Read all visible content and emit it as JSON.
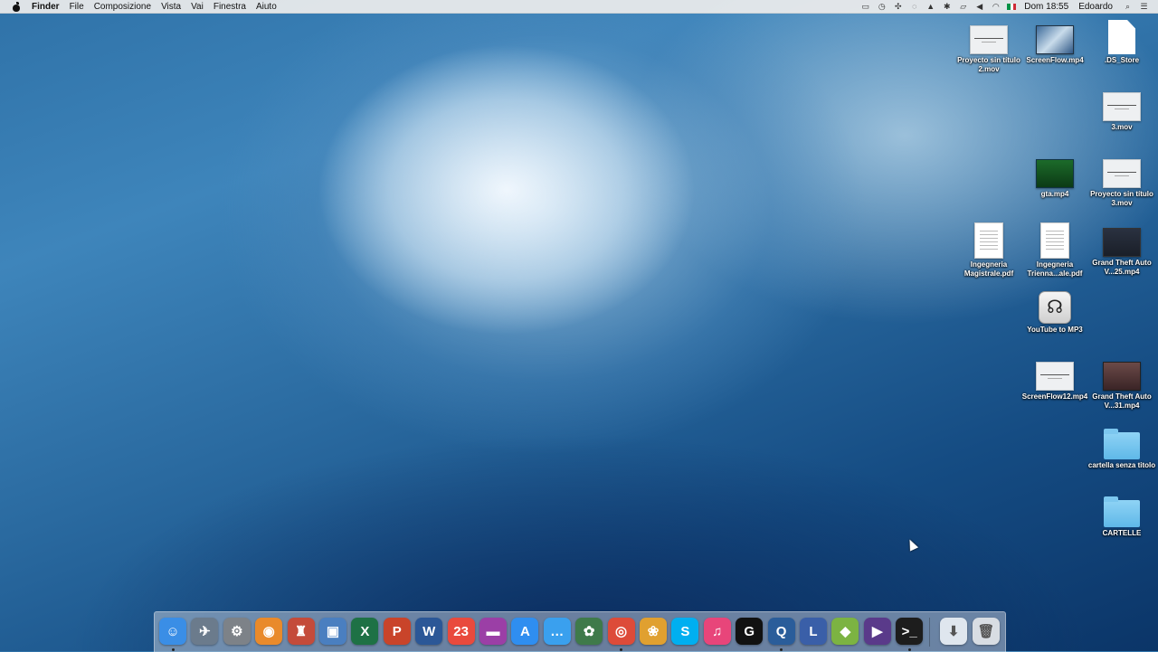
{
  "menubar": {
    "app_name": "Finder",
    "menus": [
      "File",
      "Composizione",
      "Vista",
      "Vai",
      "Finestra",
      "Aiuto"
    ],
    "clock": "Dom 18:55",
    "user": "Edoardo"
  },
  "desktop": {
    "icons": [
      {
        "label": "Proyecto sin título 2.mov",
        "kind": "movie"
      },
      {
        "label": "ScreenFlow.mp4",
        "kind": "video-screen"
      },
      {
        "label": ".DS_Store",
        "kind": "blankdoc"
      },
      {
        "label": "3.mov",
        "kind": "movie"
      },
      {
        "label": "gta.mp4",
        "kind": "video-green"
      },
      {
        "label": "Proyecto sin título 3.mov",
        "kind": "movie"
      },
      {
        "label": "Ingegneria Magistrale.pdf",
        "kind": "doc"
      },
      {
        "label": "Ingegneria Trienna...ale.pdf",
        "kind": "doc"
      },
      {
        "label": "Grand Theft Auto V...25.mp4",
        "kind": "video-dark"
      },
      {
        "label": "YouTube to MP3",
        "kind": "app"
      },
      {
        "label": "ScreenFlow12.mp4",
        "kind": "movie"
      },
      {
        "label": "Grand Theft Auto V...31.mp4",
        "kind": "video-brown"
      },
      {
        "label": "cartella senza titolo",
        "kind": "folder"
      },
      {
        "label": "CARTELLE",
        "kind": "folder"
      }
    ]
  },
  "dock": {
    "apps": [
      {
        "name": "Finder",
        "glyph": "☺",
        "color": "#3a8ee6",
        "running": true
      },
      {
        "name": "Launchpad",
        "glyph": "✈",
        "color": "#6b7b8c",
        "running": false
      },
      {
        "name": "System Preferences",
        "glyph": "⚙",
        "color": "#7d8288",
        "running": false
      },
      {
        "name": "Blender",
        "glyph": "◉",
        "color": "#e98a2b",
        "running": false
      },
      {
        "name": "Automator",
        "glyph": "♜",
        "color": "#c44b3a",
        "running": false
      },
      {
        "name": "Preview",
        "glyph": "▣",
        "color": "#4a7fc0",
        "running": false
      },
      {
        "name": "Microsoft Excel",
        "glyph": "X",
        "color": "#1e7145",
        "running": false
      },
      {
        "name": "Microsoft PowerPoint",
        "glyph": "P",
        "color": "#c9442a",
        "running": false
      },
      {
        "name": "Microsoft Word",
        "glyph": "W",
        "color": "#2b5797",
        "running": false
      },
      {
        "name": "Calendar",
        "glyph": "23",
        "color": "#e94a3d",
        "running": false
      },
      {
        "name": "iMovie Theater",
        "glyph": "▬",
        "color": "#9b3fa6",
        "running": false
      },
      {
        "name": "App Store",
        "glyph": "A",
        "color": "#2f8ef0",
        "running": false
      },
      {
        "name": "Messages",
        "glyph": "…",
        "color": "#3aa0ee",
        "running": false
      },
      {
        "name": "Image Capture",
        "glyph": "✿",
        "color": "#3f7a4a",
        "running": false
      },
      {
        "name": "Google Chrome",
        "glyph": "◎",
        "color": "#dd4b39",
        "running": true
      },
      {
        "name": "Photos",
        "glyph": "❀",
        "color": "#e0a030",
        "running": false
      },
      {
        "name": "Skype",
        "glyph": "S",
        "color": "#00aff0",
        "running": false
      },
      {
        "name": "iTunes",
        "glyph": "♫",
        "color": "#e8457a",
        "running": false
      },
      {
        "name": "GoPro Studio",
        "glyph": "G",
        "color": "#111111",
        "running": false
      },
      {
        "name": "QuickTime Player",
        "glyph": "Q",
        "color": "#2a5d9a",
        "running": true
      },
      {
        "name": "Final Cut",
        "glyph": "L",
        "color": "#3a5fa8",
        "running": false
      },
      {
        "name": "Android File Transfer",
        "glyph": "◆",
        "color": "#7cb342",
        "running": false
      },
      {
        "name": "Final Cut Pro",
        "glyph": "▶",
        "color": "#5a3a8a",
        "running": false
      },
      {
        "name": "Terminal",
        "glyph": ">_",
        "color": "#1d1d1d",
        "running": true
      }
    ],
    "right": [
      {
        "name": "Downloads",
        "glyph": "⬇",
        "color": "#dfe6ee"
      },
      {
        "name": "Trash",
        "glyph": "🗑",
        "color": "#d8dde3"
      }
    ]
  }
}
